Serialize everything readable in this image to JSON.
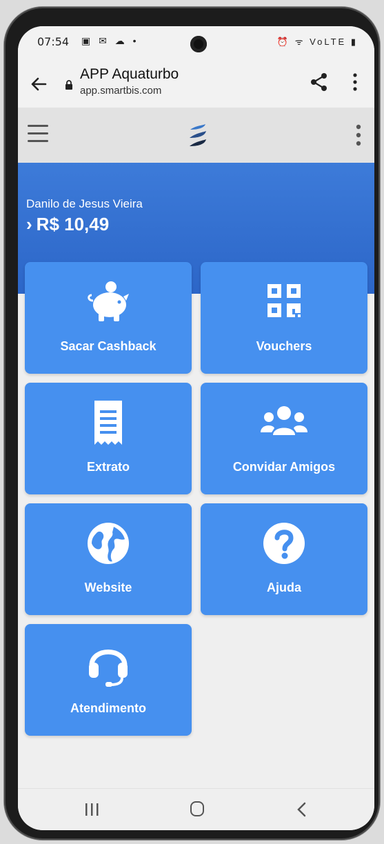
{
  "status_bar": {
    "time": "07:54",
    "left_icons": "▣ ✉ ☁ •",
    "right_icons": "⏰ ᯤ VoLTE ▮"
  },
  "browser": {
    "title": "APP Aquaturbo",
    "url": "app.smartbis.com"
  },
  "hero": {
    "user_name": "Danilo de Jesus Vieira",
    "balance_chevron": "›",
    "balance": "R$ 10,49"
  },
  "tiles": [
    {
      "label": "Sacar Cashback",
      "icon": "piggy-bank-icon"
    },
    {
      "label": "Vouchers",
      "icon": "qr-code-icon"
    },
    {
      "label": "Extrato",
      "icon": "receipt-icon"
    },
    {
      "label": "Convidar Amigos",
      "icon": "users-icon"
    },
    {
      "label": "Website",
      "icon": "globe-icon"
    },
    {
      "label": "Ajuda",
      "icon": "question-circle-icon"
    },
    {
      "label": "Atendimento",
      "icon": "headset-icon"
    }
  ],
  "colors": {
    "tile": "#4690ef",
    "hero": "#2c66c8",
    "background": "#efefef"
  }
}
